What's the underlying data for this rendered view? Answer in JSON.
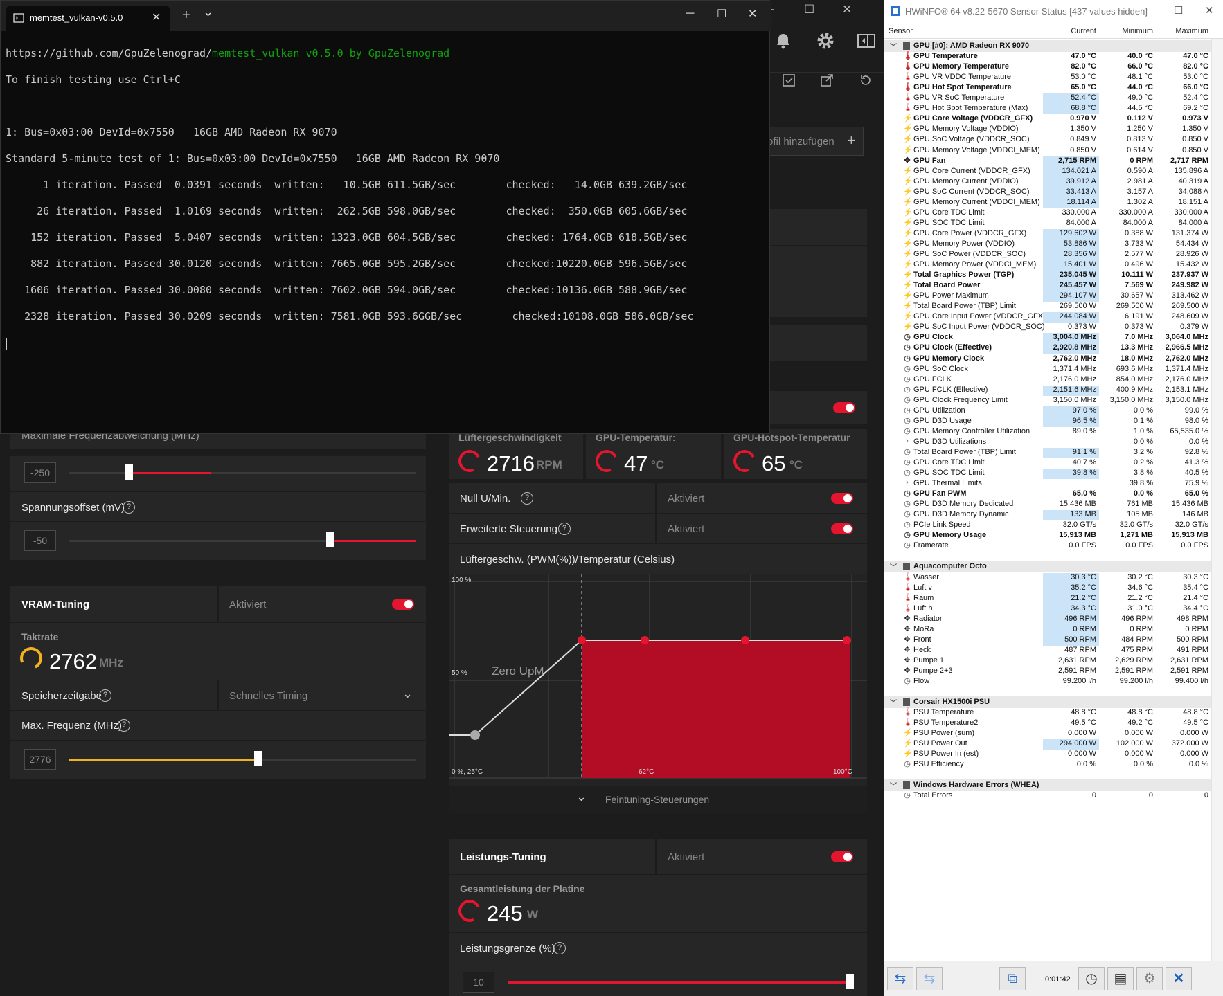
{
  "terminal": {
    "tab_title": "memtest_vulkan-v0.5.0",
    "new_tab": "+",
    "dropdown": "⌄",
    "minimize": "─",
    "maximize": "☐",
    "close": "✕",
    "line_url_prefix": "https://github.com/GpuZelenograd/",
    "line_url_rest": "memtest_vulkan v0.5.0 by GpuZelenograd",
    "line_finish": "To finish testing use Ctrl+C",
    "line_device": "1: Bus=0x03:00 DevId=0x7550   16GB AMD Radeon RX 9070",
    "line_standard": "Standard 5-minute test of 1: Bus=0x03:00 DevId=0x7550   16GB AMD Radeon RX 9070",
    "iterations": [
      "      1 iteration. Passed  0.0391 seconds  written:   10.5GB 611.5GB/sec        checked:   14.0GB 639.2GB/sec",
      "     26 iteration. Passed  1.0169 seconds  written:  262.5GB 598.0GB/sec        checked:  350.0GB 605.6GB/sec",
      "    152 iteration. Passed  5.0407 seconds  written: 1323.0GB 604.5GB/sec        checked: 1764.0GB 618.5GB/sec",
      "    882 iteration. Passed 30.0120 seconds  written: 7665.0GB 595.2GB/sec        checked:10220.0GB 596.5GB/sec",
      "   1606 iteration. Passed 30.0080 seconds  written: 7602.0GB 594.0GB/sec        checked:10136.0GB 588.9GB/sec",
      "   2328 iteration. Passed 30.0209 seconds  written: 7581.0GB 593.6GGB/sec        checked:10108.0GB 586.0GB/sec"
    ]
  },
  "amd": {
    "win_minimize": "─",
    "win_maximize": "☐",
    "win_close": "✕",
    "profile_add": "ofil hinzufügen",
    "profile_plus": "+",
    "max_freq_dev": "Maximale Frequenzabweichung (MHz)",
    "max_freq_dev_value": "-250",
    "voltage_offset": "Spannungsoffset (mV)",
    "voltage_offset_value": "-50",
    "vram_tuning": "VRAM-Tuning",
    "activated": "Aktiviert",
    "clock_rate": "Taktrate",
    "clock_value": "2762",
    "clock_unit": "MHz",
    "mem_timing": "Speicherzeitgabe",
    "mem_timing_value": "Schnelles Timing",
    "max_freq": "Max. Frequenz (MHz)",
    "max_freq_value": "2776",
    "fan_speed": "Lüftergeschwindigkeit",
    "fan_value": "2716",
    "fan_unit": "RPM",
    "gpu_temp": "GPU-Temperatur:",
    "gpu_temp_value": "47",
    "gpu_temp_unit": "°C",
    "hotspot_temp": "GPU-Hotspot-Temperatur",
    "hotspot_value": "65",
    "hotspot_unit": "°C",
    "zero_rpm": "Null U/Min.",
    "advanced_control": "Erweiterte Steuerung",
    "fan_curve_title": "Lüftergeschw. (PWM(%))/Temperatur (Celsius)",
    "fan_curve_y100": "100 %",
    "fan_curve_y50": "50 %",
    "fan_curve_origin": "0 %, 25°C",
    "fan_curve_x62": "62°C",
    "fan_curve_x100": "100°C",
    "zero_upm": "Zero UpM",
    "fine_tuning": "Feintuning-Steuerungen",
    "power_tuning": "Leistungs-Tuning",
    "board_power": "Gesamtleistung der Platine",
    "board_power_value": "245",
    "board_power_unit": "W",
    "power_limit": "Leistungsgrenze (%)",
    "power_limit_value": "10",
    "max_freq_dev_level": 0.28,
    "voltage_offset_level": 0.67,
    "max_freq_level": 0.54,
    "power_limit_level": 1.0
  },
  "hwinfo": {
    "title": "HWiNFO® 64 v8.22-5670 Sensor Status [437 values hidden]",
    "win_minimize": "─",
    "win_maximize": "☐",
    "win_close": "✕",
    "col_sensor": "Sensor",
    "col_current": "Current",
    "col_min": "Minimum",
    "col_max": "Maximum",
    "timer": "0:01:42",
    "rows": [
      {
        "g": true,
        "name": "GPU [#0]: AMD Radeon RX 9070"
      },
      {
        "i": "temp",
        "b": true,
        "name": "GPU Temperature",
        "c": "47.0 °C",
        "mi": "40.0 °C",
        "ma": "47.0 °C"
      },
      {
        "i": "temp",
        "b": true,
        "name": "GPU Memory Temperature",
        "c": "82.0 °C",
        "mi": "66.0 °C",
        "ma": "82.0 °C"
      },
      {
        "i": "temp",
        "name": "GPU VR VDDC Temperature",
        "c": "53.0 °C",
        "mi": "48.1 °C",
        "ma": "53.0 °C"
      },
      {
        "i": "temp",
        "b": true,
        "name": "GPU Hot Spot Temperature",
        "c": "65.0 °C",
        "mi": "44.0 °C",
        "ma": "66.0 °C"
      },
      {
        "i": "temp",
        "h": true,
        "name": "GPU VR SoC Temperature",
        "c": "52.4 °C",
        "mi": "49.0 °C",
        "ma": "52.4 °C"
      },
      {
        "i": "temp",
        "h": true,
        "name": "GPU Hot Spot Temperature (Max)",
        "c": "68.8 °C",
        "mi": "44.5 °C",
        "ma": "69.2 °C"
      },
      {
        "i": "volt",
        "b": true,
        "name": "GPU Core Voltage (VDDCR_GFX)",
        "c": "0.970 V",
        "mi": "0.112 V",
        "ma": "0.973 V"
      },
      {
        "i": "volt",
        "name": "GPU Memory Voltage (VDDIO)",
        "c": "1.350 V",
        "mi": "1.250 V",
        "ma": "1.350 V"
      },
      {
        "i": "volt",
        "name": "GPU SoC Voltage (VDDCR_SOC)",
        "c": "0.849 V",
        "mi": "0.813 V",
        "ma": "0.850 V"
      },
      {
        "i": "volt",
        "name": "GPU Memory Voltage (VDDCI_MEM)",
        "c": "0.850 V",
        "mi": "0.614 V",
        "ma": "0.850 V"
      },
      {
        "i": "fan",
        "b": true,
        "h": true,
        "name": "GPU Fan",
        "c": "2,715 RPM",
        "mi": "0 RPM",
        "ma": "2,717 RPM"
      },
      {
        "i": "volt",
        "h": true,
        "name": "GPU Core Current (VDDCR_GFX)",
        "c": "134.021 A",
        "mi": "0.590 A",
        "ma": "135.896 A"
      },
      {
        "i": "volt",
        "h": true,
        "name": "GPU Memory Current (VDDIO)",
        "c": "39.912 A",
        "mi": "2.981 A",
        "ma": "40.319 A"
      },
      {
        "i": "volt",
        "h": true,
        "name": "GPU SoC Current (VDDCR_SOC)",
        "c": "33.413 A",
        "mi": "3.157 A",
        "ma": "34.088 A"
      },
      {
        "i": "volt",
        "h": true,
        "name": "GPU Memory Current (VDDCI_MEM)",
        "c": "18.114 A",
        "mi": "1.302 A",
        "ma": "18.151 A"
      },
      {
        "i": "volt",
        "name": "GPU Core TDC Limit",
        "c": "330.000 A",
        "mi": "330.000 A",
        "ma": "330.000 A"
      },
      {
        "i": "volt",
        "name": "GPU SOC TDC Limit",
        "c": "84.000 A",
        "mi": "84.000 A",
        "ma": "84.000 A"
      },
      {
        "i": "volt",
        "h": true,
        "name": "GPU Core Power (VDDCR_GFX)",
        "c": "129.602 W",
        "mi": "0.388 W",
        "ma": "131.374 W"
      },
      {
        "i": "volt",
        "h": true,
        "name": "GPU Memory Power (VDDIO)",
        "c": "53.886 W",
        "mi": "3.733 W",
        "ma": "54.434 W"
      },
      {
        "i": "volt",
        "h": true,
        "name": "GPU SoC Power (VDDCR_SOC)",
        "c": "28.356 W",
        "mi": "2.577 W",
        "ma": "28.926 W"
      },
      {
        "i": "volt",
        "h": true,
        "name": "GPU Memory Power (VDDCI_MEM)",
        "c": "15.401 W",
        "mi": "0.496 W",
        "ma": "15.432 W"
      },
      {
        "i": "volt",
        "b": true,
        "h": true,
        "name": "Total Graphics Power (TGP)",
        "c": "235.045 W",
        "mi": "10.111 W",
        "ma": "237.937 W"
      },
      {
        "i": "volt",
        "b": true,
        "h": true,
        "name": "Total Board Power",
        "c": "245.457 W",
        "mi": "7.569 W",
        "ma": "249.982 W"
      },
      {
        "i": "volt",
        "h": true,
        "name": "GPU Power Maximum",
        "c": "294.107 W",
        "mi": "30.657 W",
        "ma": "313.462 W"
      },
      {
        "i": "volt",
        "name": "Total Board Power (TBP) Limit",
        "c": "269.500 W",
        "mi": "269.500 W",
        "ma": "269.500 W"
      },
      {
        "i": "volt",
        "h": true,
        "name": "GPU Core Input Power (VDDCR_GFX)",
        "c": "244.084 W",
        "mi": "6.191 W",
        "ma": "248.609 W"
      },
      {
        "i": "volt",
        "name": "GPU SoC Input Power (VDDCR_SOC)",
        "c": "0.373 W",
        "mi": "0.373 W",
        "ma": "0.379 W"
      },
      {
        "i": "clock",
        "b": true,
        "h": true,
        "name": "GPU Clock",
        "c": "3,004.0 MHz",
        "mi": "7.0 MHz",
        "ma": "3,064.0 MHz"
      },
      {
        "i": "clock",
        "b": true,
        "h": true,
        "name": "GPU Clock (Effective)",
        "c": "2,920.8 MHz",
        "mi": "13.3 MHz",
        "ma": "2,966.5 MHz"
      },
      {
        "i": "clock",
        "b": true,
        "name": "GPU Memory Clock",
        "c": "2,762.0 MHz",
        "mi": "18.0 MHz",
        "ma": "2,762.0 MHz"
      },
      {
        "i": "clock",
        "name": "GPU SoC Clock",
        "c": "1,371.4 MHz",
        "mi": "693.6 MHz",
        "ma": "1,371.4 MHz"
      },
      {
        "i": "clock",
        "name": "GPU FCLK",
        "c": "2,176.0 MHz",
        "mi": "854.0 MHz",
        "ma": "2,176.0 MHz"
      },
      {
        "i": "clock",
        "h": true,
        "name": "GPU FCLK (Effective)",
        "c": "2,151.6 MHz",
        "mi": "400.9 MHz",
        "ma": "2,153.1 MHz"
      },
      {
        "i": "clock",
        "name": "GPU Clock Frequency Limit",
        "c": "3,150.0 MHz",
        "mi": "3,150.0 MHz",
        "ma": "3,150.0 MHz"
      },
      {
        "i": "clock",
        "h": true,
        "name": "GPU Utilization",
        "c": "97.0 %",
        "mi": "0.0 %",
        "ma": "99.0 %"
      },
      {
        "i": "clock",
        "h": true,
        "name": "GPU D3D Usage",
        "c": "96.5 %",
        "mi": "0.1 %",
        "ma": "98.0 %"
      },
      {
        "i": "clock",
        "name": "GPU Memory Controller Utilization",
        "c": "89.0 %",
        "mi": "1.0 %",
        "ma": "65,535.0 %"
      },
      {
        "i": "exp",
        "name": "GPU D3D Utilizations",
        "c": "",
        "mi": "0.0 %",
        "ma": "0.0 %"
      },
      {
        "i": "clock",
        "h": true,
        "name": "Total Board Power (TBP) Limit",
        "c": "91.1 %",
        "mi": "3.2 %",
        "ma": "92.8 %"
      },
      {
        "i": "clock",
        "name": "GPU Core TDC Limit",
        "c": "40.7 %",
        "mi": "0.2 %",
        "ma": "41.3 %"
      },
      {
        "i": "clock",
        "h": true,
        "name": "GPU SOC TDC Limit",
        "c": "39.8 %",
        "mi": "3.8 %",
        "ma": "40.5 %"
      },
      {
        "i": "exp",
        "name": "GPU Thermal Limits",
        "c": "",
        "mi": "39.8 %",
        "ma": "75.9 %"
      },
      {
        "i": "clock",
        "b": true,
        "name": "GPU Fan PWM",
        "c": "65.0 %",
        "mi": "0.0 %",
        "ma": "65.0 %"
      },
      {
        "i": "clock",
        "name": "GPU D3D Memory Dedicated",
        "c": "15,436 MB",
        "mi": "761 MB",
        "ma": "15,436 MB"
      },
      {
        "i": "clock",
        "h": true,
        "name": "GPU D3D Memory Dynamic",
        "c": "133 MB",
        "mi": "105 MB",
        "ma": "146 MB"
      },
      {
        "i": "clock",
        "name": "PCIe Link Speed",
        "c": "32.0 GT/s",
        "mi": "32.0 GT/s",
        "ma": "32.0 GT/s"
      },
      {
        "i": "clock",
        "b": true,
        "name": "GPU Memory Usage",
        "c": "15,913 MB",
        "mi": "1,271 MB",
        "ma": "15,913 MB"
      },
      {
        "i": "clock",
        "name": "Framerate",
        "c": "0.0 FPS",
        "mi": "0.0 FPS",
        "ma": "0.0 FPS"
      },
      {
        "sp": true
      },
      {
        "g": true,
        "name": "Aquacomputer Octo"
      },
      {
        "i": "temp",
        "h": true,
        "name": "Wasser",
        "c": "30.3 °C",
        "mi": "30.2 °C",
        "ma": "30.3 °C"
      },
      {
        "i": "temp",
        "h": true,
        "name": "Luft v",
        "c": "35.2 °C",
        "mi": "34.6 °C",
        "ma": "35.4 °C"
      },
      {
        "i": "temp",
        "h": true,
        "name": "Raum",
        "c": "21.2 °C",
        "mi": "21.2 °C",
        "ma": "21.4 °C"
      },
      {
        "i": "temp",
        "h": true,
        "name": "Luft h",
        "c": "34.3 °C",
        "mi": "31.0 °C",
        "ma": "34.4 °C"
      },
      {
        "i": "fan",
        "h": true,
        "name": "Radiator",
        "c": "496 RPM",
        "mi": "496 RPM",
        "ma": "498 RPM"
      },
      {
        "i": "fan",
        "h": true,
        "name": "MoRa",
        "c": "0 RPM",
        "mi": "0 RPM",
        "ma": "0 RPM"
      },
      {
        "i": "fan",
        "h": true,
        "name": "Front",
        "c": "500 RPM",
        "mi": "484 RPM",
        "ma": "500 RPM"
      },
      {
        "i": "fan",
        "name": "Heck",
        "c": "487 RPM",
        "mi": "475 RPM",
        "ma": "491 RPM"
      },
      {
        "i": "fan",
        "name": "Pumpe 1",
        "c": "2,631 RPM",
        "mi": "2,629 RPM",
        "ma": "2,631 RPM"
      },
      {
        "i": "fan",
        "name": "Pumpe 2+3",
        "c": "2,591 RPM",
        "mi": "2,591 RPM",
        "ma": "2,591 RPM"
      },
      {
        "i": "clock",
        "name": "Flow",
        "c": "99.200 l/h",
        "mi": "99.200 l/h",
        "ma": "99.400 l/h"
      },
      {
        "sp": true
      },
      {
        "g": true,
        "name": "Corsair HX1500i PSU"
      },
      {
        "i": "temp",
        "name": "PSU Temperature",
        "c": "48.8 °C",
        "mi": "48.8 °C",
        "ma": "48.8 °C"
      },
      {
        "i": "temp",
        "name": "PSU Temperature2",
        "c": "49.5 °C",
        "mi": "49.2 °C",
        "ma": "49.5 °C"
      },
      {
        "i": "volt",
        "name": "PSU Power (sum)",
        "c": "0.000 W",
        "mi": "0.000 W",
        "ma": "0.000 W"
      },
      {
        "i": "volt",
        "h": true,
        "name": "PSU Power Out",
        "c": "294.000 W",
        "mi": "102.000 W",
        "ma": "372.000 W"
      },
      {
        "i": "volt",
        "name": "PSU Power In (est)",
        "c": "0.000 W",
        "mi": "0.000 W",
        "ma": "0.000 W"
      },
      {
        "i": "clock",
        "name": "PSU Efficiency",
        "c": "0.0 %",
        "mi": "0.0 %",
        "ma": "0.0 %"
      },
      {
        "sp": true
      },
      {
        "g": true,
        "name": "Windows Hardware Errors (WHEA)"
      },
      {
        "i": "clock",
        "name": "Total Errors",
        "c": "0",
        "mi": "0",
        "ma": "0"
      }
    ]
  }
}
